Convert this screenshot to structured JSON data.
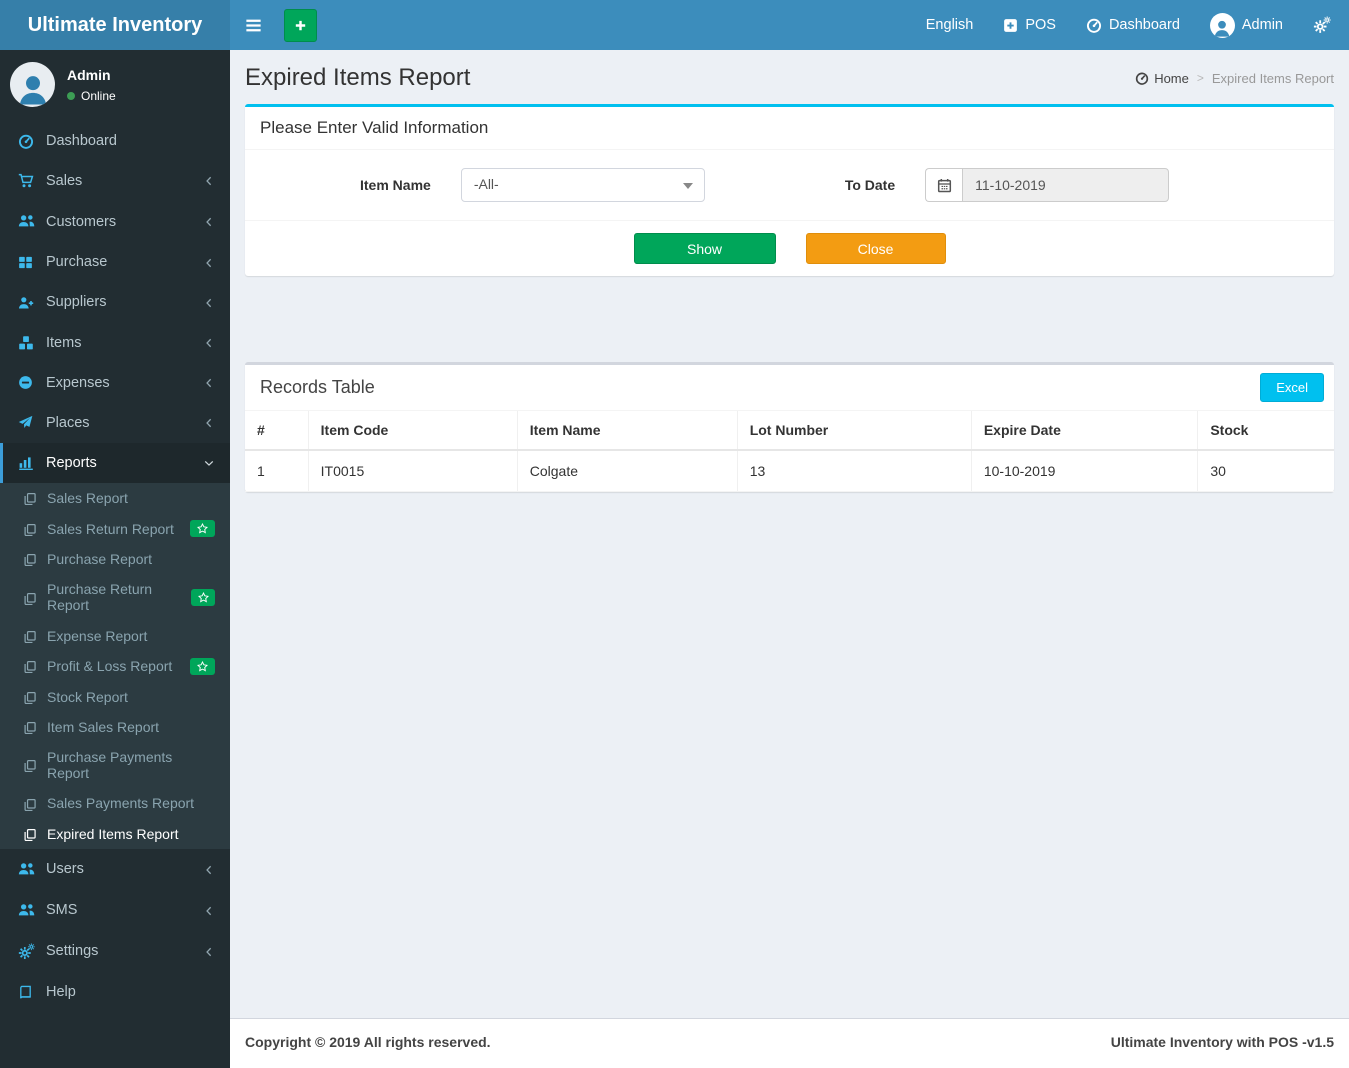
{
  "colors": {
    "navbar": "#3c8dbc",
    "logo_bg": "#367fa9",
    "sidebar_bg": "#222d32",
    "submenu_bg": "#2c3b41",
    "active_border": "#3c9dd9",
    "icon_cyan": "#3db9ec",
    "green": "#00a65a",
    "orange": "#f39c12",
    "cyan": "#00c0ef",
    "content_bg": "#ecf0f5"
  },
  "app": {
    "brand": "Ultimate Inventory"
  },
  "navbar": {
    "language": "English",
    "pos": "POS",
    "dashboard": "Dashboard",
    "user": "Admin"
  },
  "sidebar": {
    "user": {
      "name": "Admin",
      "status": "Online"
    },
    "menu": [
      {
        "label": "Dashboard"
      },
      {
        "label": "Sales"
      },
      {
        "label": "Customers"
      },
      {
        "label": "Purchase"
      },
      {
        "label": "Suppliers"
      },
      {
        "label": "Items"
      },
      {
        "label": "Expenses"
      },
      {
        "label": "Places"
      }
    ],
    "reports": {
      "label": "Reports",
      "items": [
        {
          "label": "Sales Report"
        },
        {
          "label": "Sales Return Report",
          "badge": "star"
        },
        {
          "label": "Purchase Report"
        },
        {
          "label": "Purchase Return Report",
          "badge": "star"
        },
        {
          "label": "Expense Report"
        },
        {
          "label": "Profit & Loss Report",
          "badge": "star"
        },
        {
          "label": "Stock Report"
        },
        {
          "label": "Item Sales Report"
        },
        {
          "label": "Purchase Payments Report"
        },
        {
          "label": "Sales Payments Report"
        },
        {
          "label": "Expired Items Report",
          "active": true
        }
      ]
    },
    "menu_bottom": [
      {
        "label": "Users"
      },
      {
        "label": "SMS"
      },
      {
        "label": "Settings"
      },
      {
        "label": "Help"
      }
    ]
  },
  "page": {
    "title": "Expired Items Report"
  },
  "breadcrumb": {
    "home": "Home",
    "separator": ">",
    "current": "Expired Items Report"
  },
  "filter": {
    "box_title": "Please Enter Valid Information",
    "item_name_label": "Item Name",
    "item_name_value": "-All-",
    "to_date_label": "To Date",
    "to_date_value": "11-10-2019",
    "show_label": "Show",
    "close_label": "Close"
  },
  "records": {
    "box_title": "Records Table",
    "excel_label": "Excel",
    "columns": [
      "#",
      "Item Code",
      "Item Name",
      "Lot Number",
      "Expire Date",
      "Stock"
    ],
    "rows": [
      [
        "1",
        "IT0015",
        "Colgate",
        "13",
        "10-10-2019",
        "30"
      ]
    ]
  },
  "footer": {
    "left": "Copyright © 2019 All rights reserved.",
    "right": "Ultimate Inventory with POS -v1.5"
  }
}
